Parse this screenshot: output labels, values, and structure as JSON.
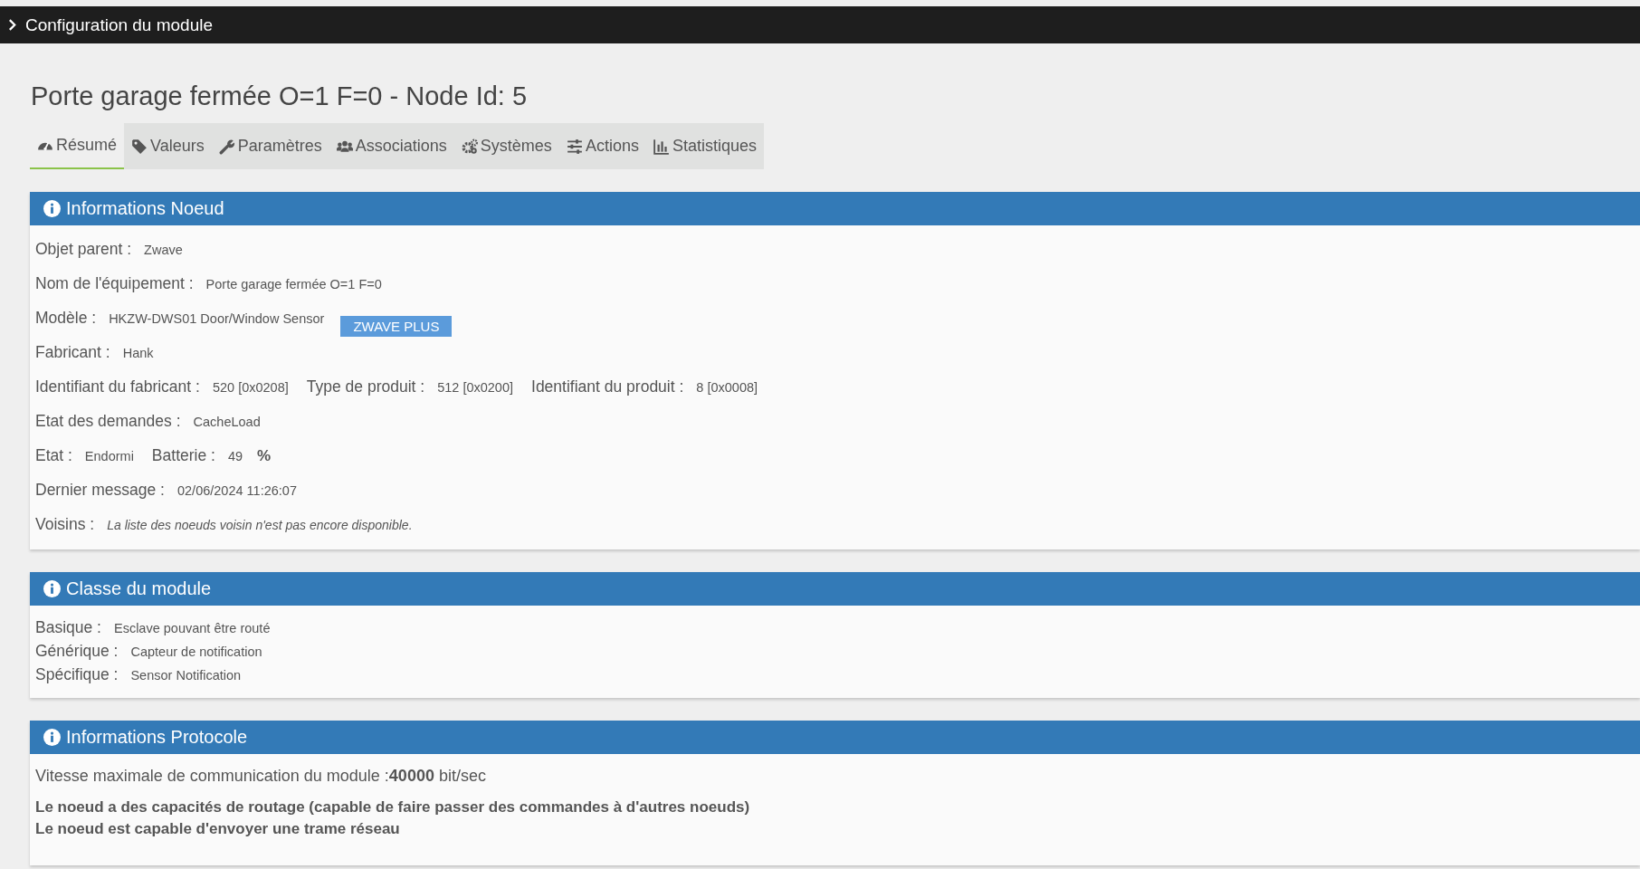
{
  "header": {
    "title": "Configuration du module"
  },
  "page_title": "Porte garage fermée O=1 F=0 - Node Id: 5",
  "tabs": [
    {
      "label": "Résumé",
      "selected": true
    },
    {
      "label": "Valeurs",
      "selected": false
    },
    {
      "label": "Paramètres",
      "selected": false
    },
    {
      "label": "Associations",
      "selected": false
    },
    {
      "label": "Systèmes",
      "selected": false
    },
    {
      "label": "Actions",
      "selected": false
    },
    {
      "label": "Statistiques",
      "selected": false
    }
  ],
  "node_info": {
    "title": "Informations Noeud",
    "rows": [
      {
        "fields": [
          {
            "label": "Objet parent :",
            "value": "Zwave",
            "kind": "text"
          }
        ]
      },
      {
        "fields": [
          {
            "label": "Nom de l'équipement :",
            "value": "Porte garage fermée O=1 F=0",
            "kind": "text"
          }
        ]
      },
      {
        "fields": [
          {
            "label": "Modèle :",
            "value": "HKZW-DWS01 Door/Window Sensor",
            "kind": "text"
          }
        ],
        "badge": "ZWAVE PLUS"
      },
      {
        "fields": [
          {
            "label": "Fabricant :",
            "value": "Hank",
            "kind": "text"
          }
        ]
      },
      {
        "fields": [
          {
            "label": "Identifiant du fabricant :",
            "value": "520 [0x0208]",
            "kind": "text"
          },
          {
            "label": "Type de produit :",
            "value": "512 [0x0200]",
            "kind": "text"
          },
          {
            "label": "Identifiant du produit :",
            "value": "8 [0x0008]",
            "kind": "text"
          }
        ]
      },
      {
        "fields": [
          {
            "label": "Etat des demandes :",
            "value": "CacheLoad",
            "kind": "text"
          }
        ]
      },
      {
        "fields": [
          {
            "label": "Etat :",
            "value": "Endormi",
            "kind": "text"
          },
          {
            "label": "Batterie :",
            "value": "49",
            "kind": "text"
          }
        ],
        "unit": "%"
      },
      {
        "fields": [
          {
            "label": "Dernier message :",
            "value": "02/06/2024 11:26:07",
            "kind": "text"
          }
        ]
      },
      {
        "fields": [
          {
            "label": "Voisins :",
            "value": "La liste des noeuds voisin n'est pas encore disponible.",
            "kind": "note"
          }
        ]
      }
    ]
  },
  "module_class": {
    "title": "Classe du module",
    "rows": [
      {
        "label": "Basique :",
        "value": "Esclave pouvant être routé"
      },
      {
        "label": "Générique :",
        "value": "Capteur de notification"
      },
      {
        "label": "Spécifique :",
        "value": "Sensor Notification"
      }
    ]
  },
  "protocol": {
    "title": "Informations Protocole",
    "speed": "Vitesse maximale de communication du module :**40000** bit/sec",
    "capabilities": [
      "Le noeud a des capacités de routage (capable de faire passer des commandes à d'autres noeuds)",
      "Le noeud est capable d'envoyer une trame réseau"
    ]
  }
}
